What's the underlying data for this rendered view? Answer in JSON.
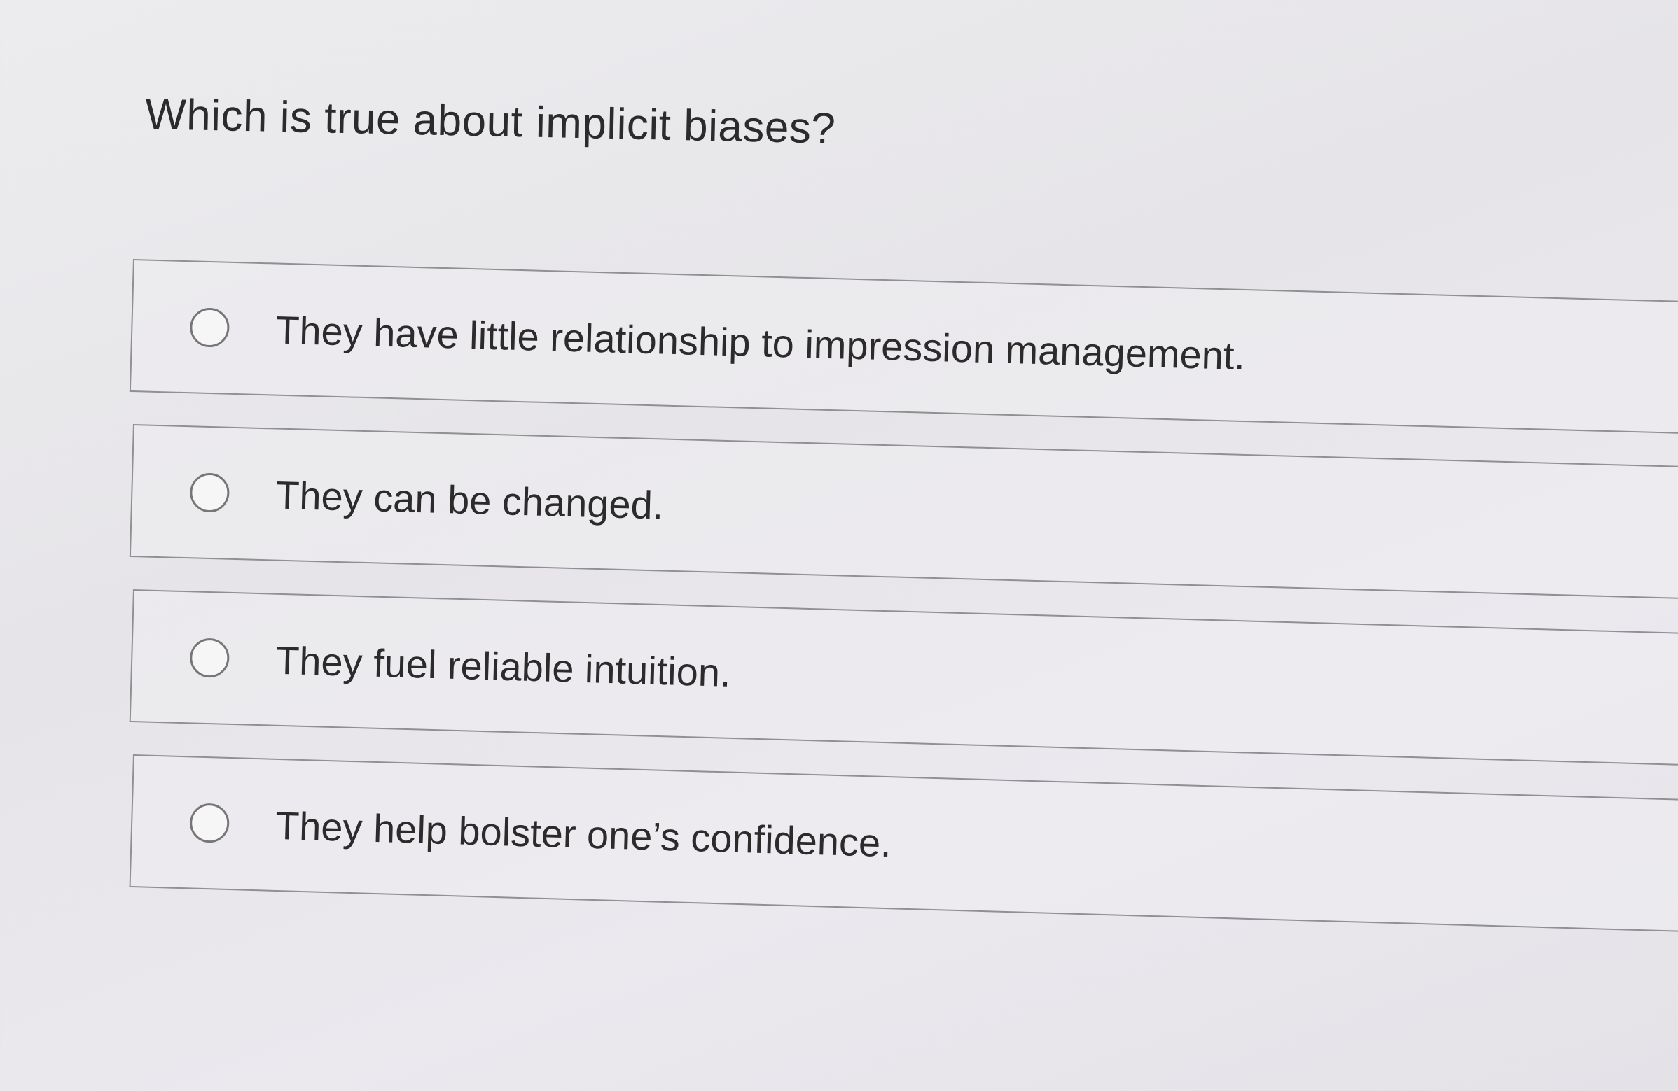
{
  "question": {
    "text": "Which is true about implicit biases?"
  },
  "options": [
    {
      "label": "They have little relationship to impression management.",
      "selected": false
    },
    {
      "label": "They can be changed.",
      "selected": false
    },
    {
      "label": "They fuel reliable intuition.",
      "selected": false
    },
    {
      "label": "They help bolster one’s confidence.",
      "selected": false
    }
  ]
}
